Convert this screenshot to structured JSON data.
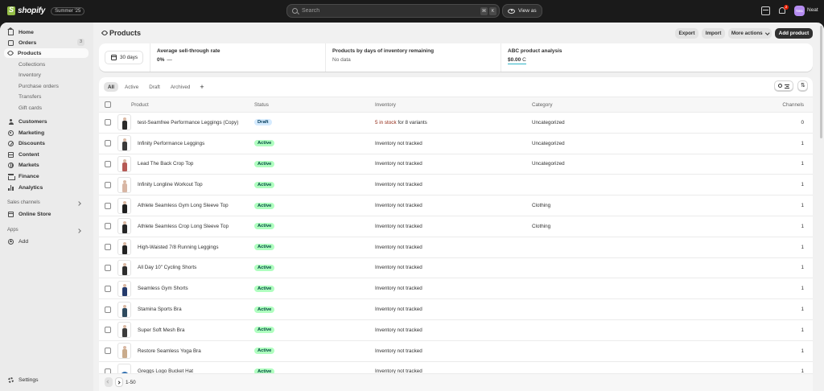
{
  "topbar": {
    "brand": "shopify",
    "edition": "Summer '25",
    "search_placeholder": "Search",
    "shortcut_keys": [
      "⌘",
      "K"
    ],
    "view_as": "View as",
    "notification_count": "2",
    "avatar_initials": "Nea",
    "user_name": "Neat",
    "colors": {
      "bar": "#1a1a1a",
      "brand_green": "#95bf47",
      "avatar": "#b58cf0",
      "notification": "#e51c00"
    }
  },
  "sidebar": {
    "primary": [
      {
        "label": "Home",
        "icon": "home-icon"
      },
      {
        "label": "Orders",
        "icon": "orders-icon",
        "count": "3"
      },
      {
        "label": "Products",
        "icon": "tag-icon",
        "active": true
      }
    ],
    "products_sub": [
      "Collections",
      "Inventory",
      "Purchase orders",
      "Transfers",
      "Gift cards"
    ],
    "secondary": [
      {
        "label": "Customers",
        "icon": "person-icon"
      },
      {
        "label": "Marketing",
        "icon": "target-icon"
      },
      {
        "label": "Discounts",
        "icon": "discount-icon"
      },
      {
        "label": "Content",
        "icon": "content-icon"
      },
      {
        "label": "Markets",
        "icon": "globe-icon"
      },
      {
        "label": "Finance",
        "icon": "bank-icon"
      },
      {
        "label": "Analytics",
        "icon": "bar-chart-icon"
      }
    ],
    "sales_channels_label": "Sales channels",
    "online_store": "Online Store",
    "apps_label": "Apps",
    "add_label": "Add",
    "settings": "Settings"
  },
  "page": {
    "title": "Products",
    "actions": {
      "export": "Export",
      "import": "Import",
      "more": "More actions",
      "add": "Add product"
    }
  },
  "analytics": {
    "date_range": "30 days",
    "metrics": [
      {
        "title": "Average sell-through rate",
        "value": "0%",
        "extra": "—"
      },
      {
        "title": "Products by days of inventory remaining",
        "value": "No data"
      },
      {
        "title": "ABC product analysis",
        "value": "$0.00",
        "extra": "C"
      }
    ],
    "accent": "#2eb3c7"
  },
  "tabs": [
    "All",
    "Active",
    "Draft",
    "Archived"
  ],
  "table": {
    "columns": [
      "Product",
      "Status",
      "Inventory",
      "Category",
      "Channels"
    ],
    "rows": [
      {
        "product": "test-Seamfree Performance Leggings (Copy)",
        "status": "Draft",
        "inventory_red": "5 in stock",
        "inventory_rest": " for 8 variants",
        "category": "Uncategorized",
        "channels": "0",
        "swatch": "#2b2b2b"
      },
      {
        "product": "Infinity Performance Leggings",
        "status": "Active",
        "inventory": "Inventory not tracked",
        "category": "Uncategorized",
        "channels": "1",
        "swatch": "#3a3a3a"
      },
      {
        "product": "Lead The Back Crop Top",
        "status": "Active",
        "inventory": "Inventory not tracked",
        "category": "Uncategorized",
        "channels": "1",
        "swatch": "#b65a55"
      },
      {
        "product": "Infinity Longline Workout Top",
        "status": "Active",
        "inventory": "Inventory not tracked",
        "category": "",
        "channels": "1",
        "swatch": "#d8b6a4"
      },
      {
        "product": "Athlete Seamless Gym Long Sleeve Top",
        "status": "Active",
        "inventory": "Inventory not tracked",
        "category": "Clothing",
        "channels": "1",
        "swatch": "#1f1f1f"
      },
      {
        "product": "Athlete Seamless Crop Long Sleeve Top",
        "status": "Active",
        "inventory": "Inventory not tracked",
        "category": "Clothing",
        "channels": "1",
        "swatch": "#262626"
      },
      {
        "product": "High-Waisted 7/8 Running Leggings",
        "status": "Active",
        "inventory": "Inventory not tracked",
        "category": "",
        "channels": "1",
        "swatch": "#222222"
      },
      {
        "product": "All Day 10\" Cycling Shorts",
        "status": "Active",
        "inventory": "Inventory not tracked",
        "category": "",
        "channels": "1",
        "swatch": "#2d2d2d"
      },
      {
        "product": "Seamless Gym Shorts",
        "status": "Active",
        "inventory": "Inventory not tracked",
        "category": "",
        "channels": "1",
        "swatch": "#243a6b"
      },
      {
        "product": "Stamina Sports Bra",
        "status": "Active",
        "inventory": "Inventory not tracked",
        "category": "",
        "channels": "1",
        "swatch": "#2e4a5e"
      },
      {
        "product": "Super Soft Mesh Bra",
        "status": "Active",
        "inventory": "Inventory not tracked",
        "category": "",
        "channels": "1",
        "swatch": "#3c3c3c"
      },
      {
        "product": "Restore Seamless Yoga Bra",
        "status": "Active",
        "inventory": "Inventory not tracked",
        "category": "",
        "channels": "1",
        "swatch": "#c9ab8c"
      },
      {
        "product": "Greggs Logo Bucket Hat",
        "status": "Active",
        "inventory": "Inventory not tracked",
        "category": "",
        "channels": "1",
        "swatch": "#2f6fb0"
      }
    ]
  },
  "pagination": {
    "range": "1-50"
  },
  "status_colors": {
    "active_bg": "#affebf",
    "active_fg": "#014b40",
    "draft_bg": "#d5ebff",
    "draft_fg": "#003a5a"
  }
}
